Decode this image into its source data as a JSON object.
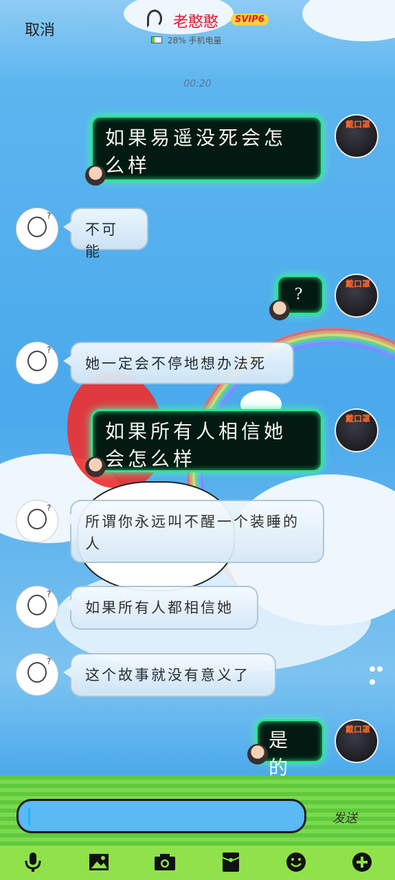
{
  "header": {
    "cancel_label": "取消",
    "title": "老憨憨",
    "vip_badge": "SVIP6",
    "status": "28% 手机电量"
  },
  "time_label": "00:20",
  "right_avatar_tag": "戴口罩",
  "messages": [
    {
      "side": "right",
      "text": "如果易遥没死会怎么样"
    },
    {
      "side": "left",
      "text": "不可能"
    },
    {
      "side": "right",
      "text": "?"
    },
    {
      "side": "left",
      "text": "她一定会不停地想办法死"
    },
    {
      "side": "right",
      "text": "如果所有人相信她会怎么样"
    },
    {
      "side": "left",
      "text": "所谓你永远叫不醒一个装睡的人"
    },
    {
      "side": "left",
      "text": "如果所有人都相信她"
    },
    {
      "side": "left",
      "text": "这个故事就没有意义了"
    },
    {
      "side": "right",
      "text": "是的"
    }
  ],
  "input": {
    "send_label": "发送"
  },
  "toolbar": [
    "microphone-icon",
    "image-icon",
    "camera-icon",
    "red-packet-icon",
    "emoji-icon",
    "plus-icon"
  ],
  "colors": {
    "bubble_border": "#2fe390",
    "sky": "#4aa9ec",
    "grass": "#5fc93a"
  }
}
